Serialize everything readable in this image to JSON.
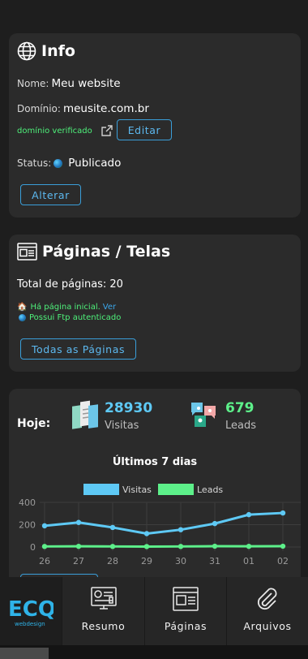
{
  "info": {
    "title": "Info",
    "name_label": "Nome:",
    "name_value": "Meu website",
    "domain_label": "Domínio:",
    "domain_value": "meusite.com.br",
    "domain_status": "domínio verificado",
    "edit_label": "Editar",
    "status_label": "Status:",
    "status_value": "Publicado",
    "change_label": "Alterar"
  },
  "pages": {
    "title": "Páginas / Telas",
    "total_label": "Total de páginas:",
    "total_value": "20",
    "home_text": "Há página inicial.",
    "home_link": "Ver",
    "ftp_text": "Possui Ftp autenticado",
    "all_pages_label": "Todas as Páginas"
  },
  "today": {
    "label": "Hoje:",
    "visits_value": "28930",
    "visits_label": "Visitas",
    "leads_value": "679",
    "leads_label": "Leads"
  },
  "chart_data": {
    "type": "line",
    "title": "Últimos 7 dias",
    "categories": [
      "26",
      "27",
      "28",
      "29",
      "30",
      "31",
      "01",
      "02"
    ],
    "series": [
      {
        "name": "Visitas",
        "color": "#5ec9f5",
        "values": [
          190,
          220,
          175,
          120,
          155,
          210,
          290,
          305
        ]
      },
      {
        "name": "Leads",
        "color": "#5df08a",
        "values": [
          5,
          6,
          5,
          4,
          5,
          7,
          6,
          7
        ]
      }
    ],
    "ylim": [
      0,
      400
    ],
    "yticks": [
      "0",
      "200",
      "400"
    ],
    "grid": true,
    "legend": "top"
  },
  "nav": {
    "logo_text": "ECQ",
    "logo_sub": "webdesign",
    "items": [
      {
        "label": "Resumo",
        "icon": "dashboard-icon"
      },
      {
        "label": "Páginas",
        "icon": "pages-icon"
      },
      {
        "label": "Arquivos",
        "icon": "paperclip-icon"
      }
    ]
  },
  "colors": {
    "accent": "#3a9ed9",
    "verified": "#4ef07a",
    "background": "#1e1e1e",
    "card": "#2b2b2b"
  }
}
